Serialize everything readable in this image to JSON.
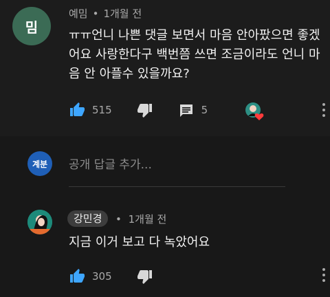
{
  "comment": {
    "avatar_letter": "밈",
    "author": "예밈",
    "separator": "•",
    "time": "1개월 전",
    "text": "ㅠㅠ언니 나쁜 댓글 보면서 마음 안아팠으면 좋겠어요 사랑한다구 백번쯤 쓰면 조금이라도 언니 마음 안 아플수 있을까요?",
    "like_count": "515",
    "reply_count": "5"
  },
  "add_reply": {
    "avatar_text": "계분",
    "placeholder": "공개 답글 추가..."
  },
  "reply": {
    "author": "강민경",
    "separator": "•",
    "time": "1개월 전",
    "text": "지금 이거 보고 다 녹았어요",
    "like_count": "305"
  },
  "colors": {
    "like_blue": "#3ea6ff",
    "heart_red": "#ff3b3b",
    "background": "#181818"
  }
}
